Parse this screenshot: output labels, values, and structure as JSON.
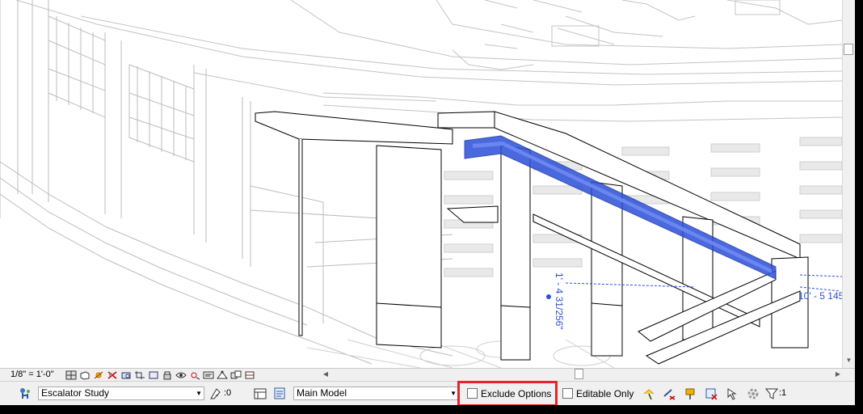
{
  "viewport": {
    "annotations": [
      "1' - 4 31/256\"",
      "10' - 5 145"
    ]
  },
  "view_control": {
    "scale": "1/8\" = 1'-0\"",
    "icons": [
      "detail-level-icon",
      "visual-style-icon",
      "sun-path-icon",
      "shadows-icon",
      "render-icon",
      "crop-view-icon",
      "show-crop-region-icon",
      "unlock-3d-view-icon",
      "temporary-hide-icon",
      "reveal-hidden-icon",
      "temporary-view-properties-icon",
      "analytical-model-icon",
      "highlight-displacement-icon",
      "show-constraints-icon"
    ]
  },
  "status": {
    "design_option": "Escalator Study",
    "worksharing_count": ":0",
    "workset": "Main Model",
    "exclude_options_label": "Exclude Options",
    "editable_only_label": "Editable Only",
    "filter_count": ":1"
  },
  "colors": {
    "highlight_box": "#e5242b",
    "selection_blue": "#2b50d8"
  }
}
